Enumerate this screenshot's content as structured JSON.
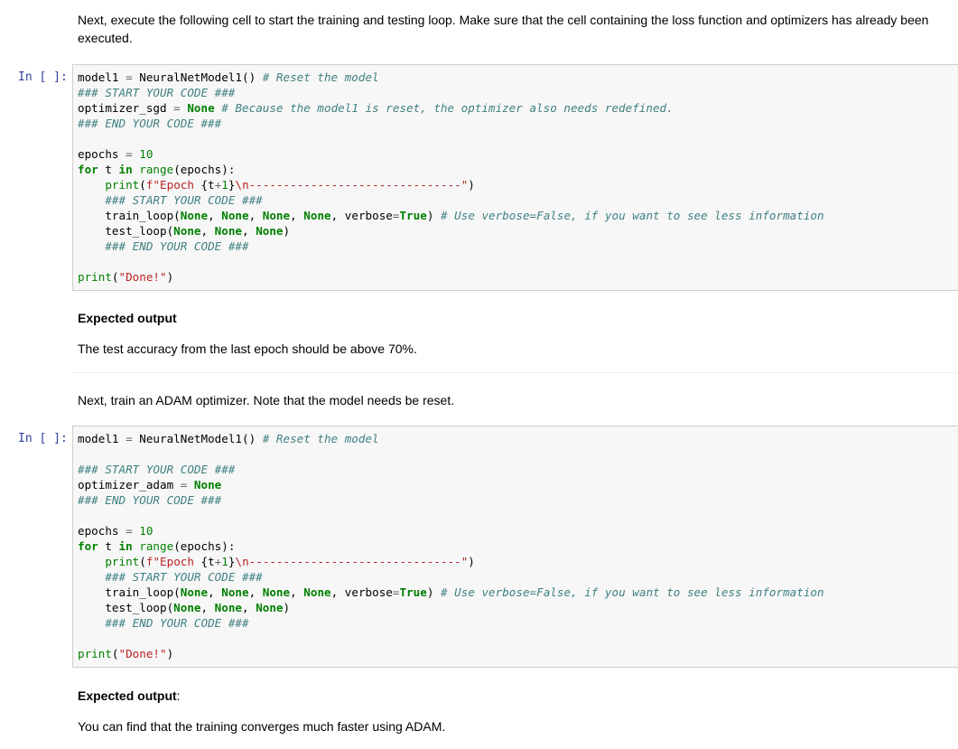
{
  "md1": {
    "text": "Next, execute the following cell to start the training and testing loop. Make sure that the cell containing the loss function and optimizers has already been executed."
  },
  "cell1": {
    "prompt": "In [ ]:",
    "lines": [
      [
        [
          "n",
          "model1 "
        ],
        [
          "op",
          "="
        ],
        [
          "n",
          " NeuralNetModel1() "
        ],
        [
          "cm",
          "# Reset the model"
        ]
      ],
      [
        [
          "cm",
          "### START YOUR CODE ###"
        ]
      ],
      [
        [
          "n",
          "optimizer_sgd "
        ],
        [
          "op",
          "="
        ],
        [
          "n",
          " "
        ],
        [
          "kc",
          "None"
        ],
        [
          "n",
          " "
        ],
        [
          "cm",
          "# Because the model1 is reset, the optimizer also needs redefined."
        ]
      ],
      [
        [
          "cm",
          "### END YOUR CODE ###"
        ]
      ],
      [],
      [
        [
          "n",
          "epochs "
        ],
        [
          "op",
          "="
        ],
        [
          "n",
          " "
        ],
        [
          "nm",
          "10"
        ]
      ],
      [
        [
          "kw",
          "for"
        ],
        [
          "n",
          " t "
        ],
        [
          "kw",
          "in"
        ],
        [
          "n",
          " "
        ],
        [
          "bi",
          "range"
        ],
        [
          "n",
          "(epochs):"
        ]
      ],
      [
        [
          "n",
          "    "
        ],
        [
          "bi",
          "print"
        ],
        [
          "n",
          "("
        ],
        [
          "st",
          "f\"Epoch "
        ],
        [
          "n",
          "{t"
        ],
        [
          "op",
          "+"
        ],
        [
          "nm",
          "1"
        ],
        [
          "n",
          "}"
        ],
        [
          "st",
          "\\n-------------------------------\""
        ],
        [
          "n",
          ")"
        ]
      ],
      [
        [
          "n",
          "    "
        ],
        [
          "cm",
          "### START YOUR CODE ###"
        ]
      ],
      [
        [
          "n",
          "    train_loop("
        ],
        [
          "kc",
          "None"
        ],
        [
          "n",
          ", "
        ],
        [
          "kc",
          "None"
        ],
        [
          "n",
          ", "
        ],
        [
          "kc",
          "None"
        ],
        [
          "n",
          ", "
        ],
        [
          "kc",
          "None"
        ],
        [
          "n",
          ", verbose"
        ],
        [
          "op",
          "="
        ],
        [
          "kc",
          "True"
        ],
        [
          "n",
          ") "
        ],
        [
          "cm",
          "# Use verbose=False, if you want to see less information"
        ]
      ],
      [
        [
          "n",
          "    test_loop("
        ],
        [
          "kc",
          "None"
        ],
        [
          "n",
          ", "
        ],
        [
          "kc",
          "None"
        ],
        [
          "n",
          ", "
        ],
        [
          "kc",
          "None"
        ],
        [
          "n",
          ")"
        ]
      ],
      [
        [
          "n",
          "    "
        ],
        [
          "cm",
          "### END YOUR CODE ###"
        ]
      ],
      [],
      [
        [
          "bi",
          "print"
        ],
        [
          "n",
          "("
        ],
        [
          "st",
          "\"Done!\""
        ],
        [
          "n",
          ")"
        ]
      ]
    ]
  },
  "md2": {
    "heading": "Expected output",
    "text": "The test accuracy from the last epoch should be above 70%."
  },
  "md3": {
    "text": "Next, train an ADAM optimizer. Note that the model needs be reset."
  },
  "cell2": {
    "prompt": "In [ ]:",
    "lines": [
      [
        [
          "n",
          "model1 "
        ],
        [
          "op",
          "="
        ],
        [
          "n",
          " NeuralNetModel1() "
        ],
        [
          "cm",
          "# Reset the model"
        ]
      ],
      [],
      [
        [
          "cm",
          "### START YOUR CODE ###"
        ]
      ],
      [
        [
          "n",
          "optimizer_adam "
        ],
        [
          "op",
          "="
        ],
        [
          "n",
          " "
        ],
        [
          "kc",
          "None"
        ]
      ],
      [
        [
          "cm",
          "### END YOUR CODE ###"
        ]
      ],
      [],
      [
        [
          "n",
          "epochs "
        ],
        [
          "op",
          "="
        ],
        [
          "n",
          " "
        ],
        [
          "nm",
          "10"
        ]
      ],
      [
        [
          "kw",
          "for"
        ],
        [
          "n",
          " t "
        ],
        [
          "kw",
          "in"
        ],
        [
          "n",
          " "
        ],
        [
          "bi",
          "range"
        ],
        [
          "n",
          "(epochs):"
        ]
      ],
      [
        [
          "n",
          "    "
        ],
        [
          "bi",
          "print"
        ],
        [
          "n",
          "("
        ],
        [
          "st",
          "f\"Epoch "
        ],
        [
          "n",
          "{t"
        ],
        [
          "op",
          "+"
        ],
        [
          "nm",
          "1"
        ],
        [
          "n",
          "}"
        ],
        [
          "st",
          "\\n-------------------------------\""
        ],
        [
          "n",
          ")"
        ]
      ],
      [
        [
          "n",
          "    "
        ],
        [
          "cm",
          "### START YOUR CODE ###"
        ]
      ],
      [
        [
          "n",
          "    train_loop("
        ],
        [
          "kc",
          "None"
        ],
        [
          "n",
          ", "
        ],
        [
          "kc",
          "None"
        ],
        [
          "n",
          ", "
        ],
        [
          "kc",
          "None"
        ],
        [
          "n",
          ", "
        ],
        [
          "kc",
          "None"
        ],
        [
          "n",
          ", verbose"
        ],
        [
          "op",
          "="
        ],
        [
          "kc",
          "True"
        ],
        [
          "n",
          ") "
        ],
        [
          "cm",
          "# Use verbose=False, if you want to see less information"
        ]
      ],
      [
        [
          "n",
          "    test_loop("
        ],
        [
          "kc",
          "None"
        ],
        [
          "n",
          ", "
        ],
        [
          "kc",
          "None"
        ],
        [
          "n",
          ", "
        ],
        [
          "kc",
          "None"
        ],
        [
          "n",
          ")"
        ]
      ],
      [
        [
          "n",
          "    "
        ],
        [
          "cm",
          "### END YOUR CODE ###"
        ]
      ],
      [],
      [
        [
          "bi",
          "print"
        ],
        [
          "n",
          "("
        ],
        [
          "st",
          "\"Done!\""
        ],
        [
          "n",
          ")"
        ]
      ]
    ]
  },
  "md4": {
    "heading": "Expected output",
    "heading_suffix": ":",
    "text": "You can find that the training converges much faster using ADAM."
  }
}
